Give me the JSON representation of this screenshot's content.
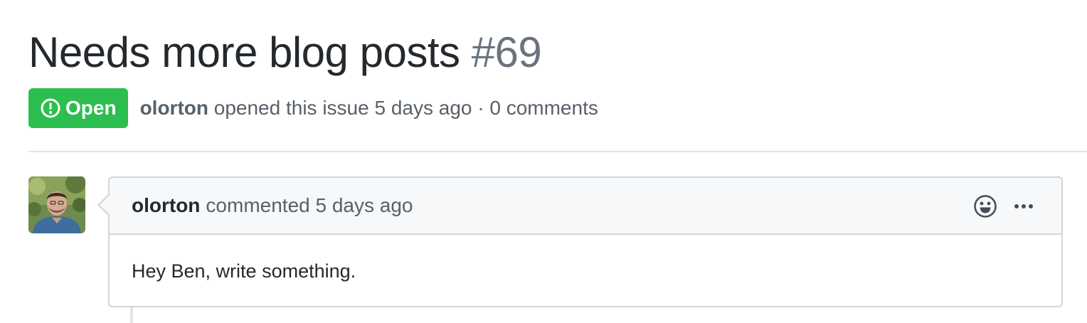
{
  "issue": {
    "title": "Needs more blog posts",
    "number": "#69",
    "state_label": "Open",
    "author": "olorton",
    "meta_text": "opened this issue 5 days ago · 0 comments"
  },
  "comment": {
    "author": "olorton",
    "action": "commented 5 days ago",
    "body": "Hey Ben, write something."
  },
  "icons": {
    "state": "issue-opened-icon",
    "reaction": "smiley-icon",
    "more": "kebab-horizontal-icon"
  },
  "colors": {
    "open_green": "#2cbe4e",
    "muted_text": "#586069",
    "number_gray": "#6a737d",
    "border": "#d1d5da",
    "header_bg": "#f6f8fa"
  }
}
